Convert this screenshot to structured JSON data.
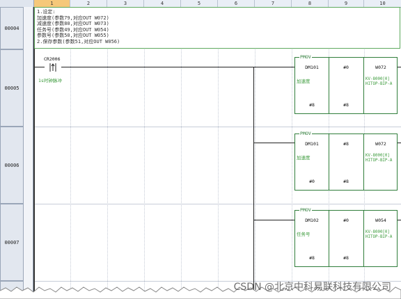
{
  "columns": [
    "1",
    "2",
    "3",
    "4",
    "5",
    "6",
    "7",
    "8",
    "9",
    "10"
  ],
  "rows": [
    {
      "num": "00004"
    },
    {
      "num": "00005"
    },
    {
      "num": "00006"
    },
    {
      "num": "00007"
    }
  ],
  "comment": [
    "1.设定:",
    "加速度(参数79,对应OUT W072)",
    "减速度(参数80,对应OUT W073)",
    "任务号(参数49,对应OUT W054)",
    "参数号(参数50,对应OUT W055)",
    "2.保存参数(参数51,对应OUT W056)"
  ],
  "contact": {
    "device": "CR2006",
    "comment": "1s时钟脉冲"
  },
  "blocks": [
    {
      "title": "PMOV",
      "src": "DM101",
      "src_comment": "加速度",
      "n1": "#0",
      "dst": "W072",
      "dst_comment": "KV-8000[0] HITOP-BIP-A",
      "s1": "#8",
      "s2": "#8"
    },
    {
      "title": "PMOV",
      "src": "DM101",
      "src_comment": "加速度",
      "n1": "#8",
      "dst": "W072",
      "dst_comment": "KV-8000[0] HITOP-BIP-A",
      "s1": "#0",
      "s2": "#8"
    },
    {
      "title": "PMOV",
      "src": "DM102",
      "src_comment": "任务号",
      "n1": "#0",
      "dst": "W054",
      "dst_comment": "KV-8000[0] HITOP-BIP-A",
      "s1": "#8",
      "s2": "#8"
    }
  ],
  "watermark": "CSDN @北京中科易联科技有限公司"
}
